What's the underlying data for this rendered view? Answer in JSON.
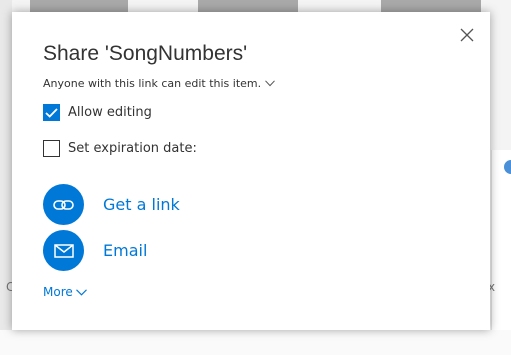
{
  "dialog": {
    "title": "Share 'SongNumbers'",
    "link_permission_text": "Anyone with this link can edit this item.",
    "options": {
      "allow_editing_label": "Allow editing",
      "allow_editing_checked": true,
      "expiration_label": "Set expiration date:",
      "expiration_checked": false
    },
    "actions": {
      "get_link_label": "Get a link",
      "email_label": "Email"
    },
    "more_label": "More"
  },
  "background": {
    "left_partial_text": "C",
    "right_partial_text": "x"
  },
  "colors": {
    "accent": "#0078d7",
    "text": "#333333"
  }
}
